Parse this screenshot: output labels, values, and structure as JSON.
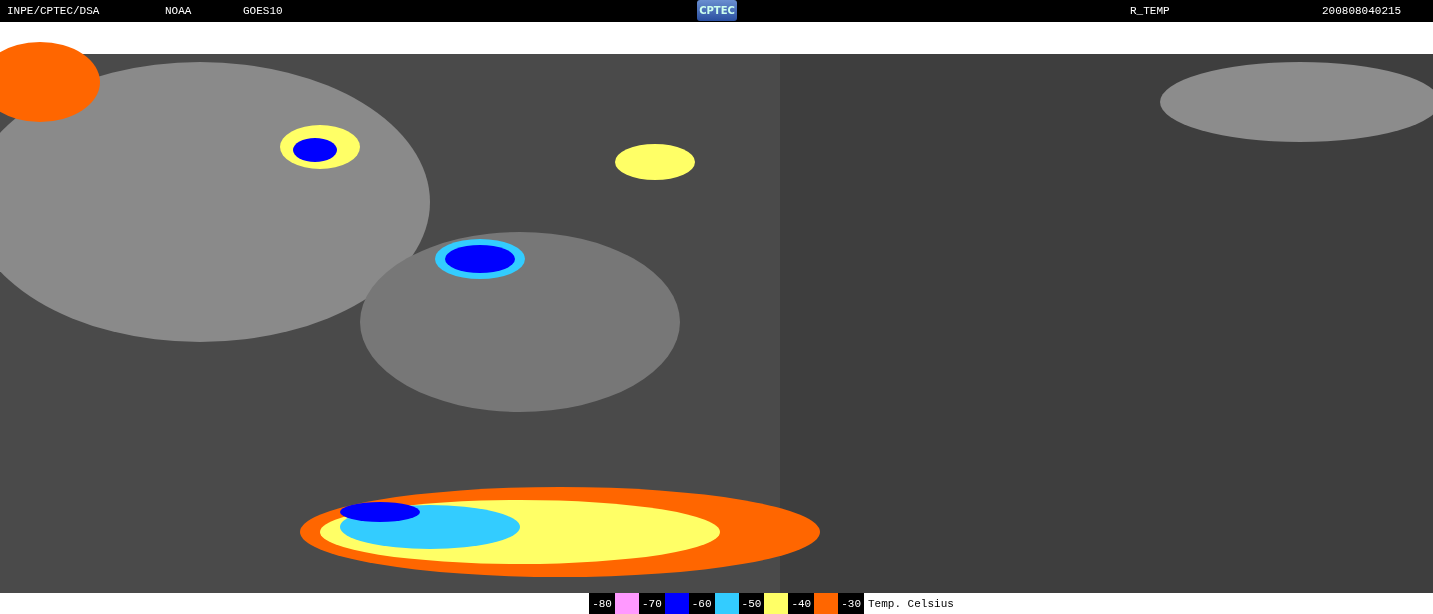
{
  "header": {
    "source": "INPE/CPTEC/DSA",
    "agency": "NOAA",
    "satellite": "GOES10",
    "logo": "CPTEC",
    "product": "R_TEMP",
    "timestamp": "200808040215"
  },
  "legend": {
    "items": [
      {
        "label": "-80",
        "color": "#ff99ff"
      },
      {
        "label": "-70",
        "color": "#0000ff"
      },
      {
        "label": "-60",
        "color": "#33ccff"
      },
      {
        "label": "-50",
        "color": "#ffff66"
      },
      {
        "label": "-40",
        "color": "#ff6600"
      },
      {
        "label": "-30"
      }
    ],
    "unit": "Temp. Celsius"
  }
}
